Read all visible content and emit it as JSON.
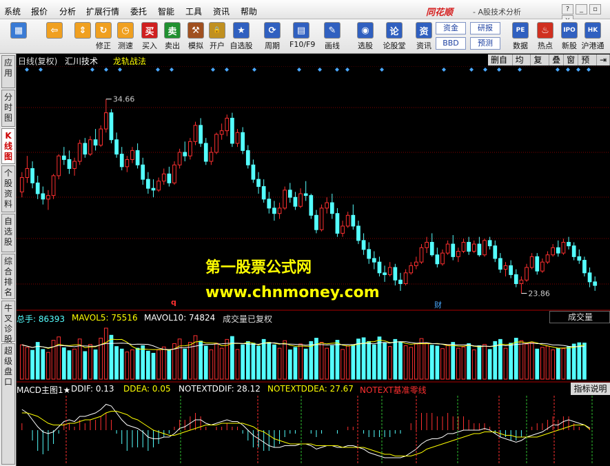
{
  "menu": [
    "系统",
    "报价",
    "分析",
    "扩展行情",
    "委托",
    "智能",
    "工具",
    "资讯",
    "帮助"
  ],
  "brand": "同花顺",
  "app_title": "- A股技术分析",
  "toolbar": [
    {
      "label": "",
      "icon": "windows-icon",
      "color": "#3a7bd5"
    },
    {
      "label": "",
      "icon": "back-arrow-icon",
      "color": "#f0a020"
    },
    {
      "label": "",
      "icon": "up-down-icon",
      "color": "#f0a020"
    },
    {
      "label": "修正",
      "icon": "refresh-icon",
      "color": "#f0a020"
    },
    {
      "label": "测速",
      "icon": "clock-icon",
      "color": "#f0a020"
    },
    {
      "label": "买入",
      "icon": "buy-icon",
      "color": "#d02020"
    },
    {
      "label": "卖出",
      "icon": "sell-icon",
      "color": "#209030"
    },
    {
      "label": "模拟",
      "icon": "hammer-icon",
      "color": "#a05020"
    },
    {
      "label": "开户",
      "icon": "lock-icon",
      "color": "#c09020"
    },
    {
      "label": "自选股",
      "icon": "star-folder-icon",
      "color": "#3060c0"
    },
    {
      "label": "周期",
      "icon": "cycle-icon",
      "color": "#3060c0"
    },
    {
      "label": "F10/F9",
      "icon": "f10-icon",
      "color": "#3060c0"
    },
    {
      "label": "画线",
      "icon": "pen-icon",
      "color": "#3060c0"
    },
    {
      "label": "选股",
      "icon": "select-stock-icon",
      "color": "#3060c0"
    },
    {
      "label": "论股堂",
      "icon": "forum-icon",
      "color": "#3060c0"
    },
    {
      "label": "资讯",
      "icon": "news-icon",
      "color": "#3060c0"
    },
    {
      "label": "数据",
      "icon": "pe-icon",
      "color": "#3060c0"
    },
    {
      "label": "热点",
      "icon": "fire-icon",
      "color": "#d03020"
    },
    {
      "label": "新股",
      "icon": "ipo-icon",
      "color": "#3060c0"
    },
    {
      "label": "沪港通",
      "icon": "sse-hk-icon",
      "color": "#3060c0"
    }
  ],
  "toolbar_small": {
    "zijin": "资金",
    "bbd": "BBD",
    "yanbao": "研报",
    "yuce": "预测"
  },
  "side_tabs": [
    "应用",
    "分时图",
    "K线图",
    "个股资料",
    "自选股",
    "综合排名",
    "牛叉诊股",
    "超级盘口"
  ],
  "info": {
    "period": "日线(复权)",
    "stock": "汇川技术",
    "strategy": "龙轨战法"
  },
  "chart_tools": [
    "删自选",
    "均线",
    "复权",
    "叠",
    "窗",
    "预测",
    "⇥"
  ],
  "price_labels": {
    "high": "34.66",
    "low": "23.86"
  },
  "markers": {
    "q": "q",
    "cai": "财"
  },
  "volume_header": {
    "total": "总手: 86393",
    "mavol5": "MAVOL5: 75516",
    "mavol10": "MAVOL10: 74824",
    "note": "成交量已复权",
    "select": "成交量"
  },
  "macd_header": {
    "name": "MACD主图1★",
    "ddif": "DDIF: 0.13",
    "ddea": "DDEA: 0.05",
    "ntddif": "NOTEXTDDIF: 28.12",
    "ntddea": "NOTEXTDDEA: 27.67",
    "baseline": "NOTEXT基准零线",
    "btn": "指标说明"
  },
  "watermark": {
    "line1": "第一股票公式网",
    "line2": "www.chnmoney.com"
  },
  "colors": {
    "up": "#ff3030",
    "down": "#54ffff",
    "ma_white": "#ffffff",
    "ma_yellow": "#ffff00",
    "grid": "#880000"
  },
  "chart_data": {
    "type": "candlestick",
    "ohlc": [
      [
        29.5,
        30.6,
        29.2,
        30.3
      ],
      [
        30.3,
        31.5,
        30.0,
        30.8
      ],
      [
        30.8,
        31.2,
        29.7,
        30.0
      ],
      [
        30.0,
        30.4,
        29.1,
        29.4
      ],
      [
        29.4,
        29.8,
        28.8,
        29.1
      ],
      [
        29.1,
        29.6,
        28.5,
        29.3
      ],
      [
        29.3,
        30.5,
        29.1,
        30.4
      ],
      [
        30.4,
        31.6,
        30.2,
        31.5
      ],
      [
        31.5,
        32.0,
        31.0,
        31.3
      ],
      [
        31.3,
        31.8,
        30.5,
        30.8
      ],
      [
        30.8,
        31.4,
        30.4,
        31.2
      ],
      [
        31.2,
        32.4,
        31.0,
        32.2
      ],
      [
        32.2,
        32.5,
        31.4,
        31.6
      ],
      [
        31.6,
        32.6,
        31.5,
        32.4
      ],
      [
        32.4,
        33.0,
        31.8,
        32.1
      ],
      [
        32.1,
        33.2,
        32.0,
        33.0
      ],
      [
        33.0,
        34.66,
        32.8,
        33.9
      ],
      [
        33.9,
        34.1,
        32.2,
        32.4
      ],
      [
        32.4,
        32.8,
        31.4,
        31.6
      ],
      [
        31.6,
        32.0,
        30.7,
        30.9
      ],
      [
        30.9,
        31.5,
        30.6,
        31.3
      ],
      [
        31.3,
        32.0,
        31.1,
        31.8
      ],
      [
        31.8,
        32.2,
        30.8,
        31.0
      ],
      [
        31.0,
        31.4,
        29.9,
        30.2
      ],
      [
        30.2,
        30.6,
        29.4,
        29.7
      ],
      [
        29.7,
        30.2,
        29.2,
        29.6
      ],
      [
        29.6,
        30.3,
        29.5,
        30.1
      ],
      [
        30.1,
        30.8,
        29.9,
        30.5
      ],
      [
        30.5,
        30.9,
        29.8,
        30.0
      ],
      [
        30.0,
        31.2,
        29.9,
        31.0
      ],
      [
        31.0,
        31.9,
        30.8,
        31.7
      ],
      [
        31.7,
        32.3,
        31.2,
        31.5
      ],
      [
        31.5,
        32.5,
        31.3,
        32.3
      ],
      [
        32.3,
        33.4,
        32.1,
        33.2
      ],
      [
        33.2,
        33.6,
        32.0,
        32.2
      ],
      [
        32.2,
        32.5,
        31.0,
        31.2
      ],
      [
        31.2,
        32.0,
        31.0,
        31.7
      ],
      [
        31.7,
        32.8,
        31.6,
        32.7
      ],
      [
        32.7,
        33.3,
        32.4,
        32.9
      ],
      [
        32.9,
        33.8,
        32.6,
        33.6
      ],
      [
        33.6,
        33.9,
        32.0,
        32.2
      ],
      [
        32.2,
        33.0,
        32.0,
        32.8
      ],
      [
        32.8,
        33.1,
        31.6,
        31.8
      ],
      [
        31.8,
        32.1,
        30.8,
        31.0
      ],
      [
        31.0,
        31.3,
        30.0,
        30.2
      ],
      [
        30.2,
        30.6,
        29.4,
        29.8
      ],
      [
        29.8,
        30.2,
        28.9,
        29.1
      ],
      [
        29.1,
        29.5,
        28.3,
        28.6
      ],
      [
        28.6,
        29.0,
        27.9,
        28.3
      ],
      [
        28.3,
        28.9,
        28.0,
        28.6
      ],
      [
        28.6,
        29.8,
        28.5,
        29.6
      ],
      [
        29.6,
        30.0,
        28.9,
        29.2
      ],
      [
        29.2,
        29.5,
        28.5,
        28.7
      ],
      [
        28.7,
        29.7,
        28.6,
        29.4
      ],
      [
        29.4,
        30.1,
        29.0,
        29.3
      ],
      [
        29.3,
        29.4,
        28.0,
        28.2
      ],
      [
        28.2,
        28.5,
        27.2,
        27.4
      ],
      [
        27.4,
        28.8,
        27.3,
        28.6
      ],
      [
        28.6,
        29.2,
        28.3,
        28.9
      ],
      [
        28.9,
        29.4,
        28.0,
        28.3
      ],
      [
        28.3,
        28.6,
        27.0,
        27.2
      ],
      [
        27.2,
        27.9,
        27.0,
        27.6
      ],
      [
        27.6,
        28.4,
        27.5,
        28.2
      ],
      [
        28.2,
        28.8,
        27.4,
        27.6
      ],
      [
        27.6,
        27.9,
        26.6,
        26.8
      ],
      [
        26.8,
        27.2,
        26.0,
        26.3
      ],
      [
        26.3,
        26.7,
        25.5,
        25.8
      ],
      [
        25.8,
        26.2,
        25.2,
        25.6
      ],
      [
        25.6,
        25.9,
        24.8,
        25.0
      ],
      [
        25.0,
        25.4,
        24.5,
        24.9
      ],
      [
        24.9,
        25.6,
        24.8,
        25.3
      ],
      [
        25.3,
        25.5,
        24.3,
        24.6
      ],
      [
        24.6,
        25.0,
        24.0,
        24.4
      ],
      [
        24.4,
        25.2,
        24.3,
        25.0
      ],
      [
        25.0,
        25.6,
        24.9,
        25.4
      ],
      [
        25.4,
        25.9,
        25.2,
        25.6
      ],
      [
        25.6,
        26.6,
        25.5,
        26.4
      ],
      [
        26.4,
        27.0,
        26.1,
        26.7
      ],
      [
        26.7,
        27.2,
        25.9,
        26.0
      ],
      [
        26.0,
        26.4,
        25.3,
        25.5
      ],
      [
        25.5,
        26.3,
        25.4,
        26.1
      ],
      [
        26.1,
        26.8,
        26.0,
        26.6
      ],
      [
        26.6,
        27.1,
        25.7,
        25.9
      ],
      [
        25.9,
        26.4,
        25.6,
        26.2
      ],
      [
        26.2,
        26.9,
        26.1,
        26.7
      ],
      [
        26.7,
        27.0,
        26.0,
        26.2
      ],
      [
        26.2,
        26.8,
        26.1,
        26.6
      ],
      [
        26.6,
        27.0,
        25.9,
        26.0
      ],
      [
        26.0,
        26.9,
        25.9,
        26.8
      ],
      [
        26.8,
        27.0,
        26.3,
        26.5
      ],
      [
        26.5,
        26.8,
        25.6,
        25.8
      ],
      [
        25.8,
        26.1,
        25.0,
        25.2
      ],
      [
        25.2,
        25.6,
        24.8,
        25.4
      ],
      [
        25.4,
        25.7,
        24.7,
        24.9
      ],
      [
        24.9,
        25.2,
        24.2,
        24.4
      ],
      [
        24.4,
        24.8,
        23.86,
        24.6
      ],
      [
        24.6,
        25.5,
        24.5,
        25.3
      ],
      [
        25.3,
        26.1,
        25.2,
        25.9
      ],
      [
        25.9,
        26.1,
        24.9,
        25.1
      ],
      [
        25.1,
        25.8,
        25.0,
        25.6
      ],
      [
        25.6,
        26.2,
        25.5,
        26.0
      ],
      [
        26.0,
        26.6,
        25.9,
        26.4
      ],
      [
        26.4,
        26.8,
        25.9,
        26.1
      ],
      [
        26.1,
        26.9,
        26.0,
        26.7
      ],
      [
        26.7,
        27.0,
        26.3,
        26.5
      ],
      [
        26.5,
        26.7,
        25.7,
        25.9
      ],
      [
        25.9,
        26.3,
        25.5,
        25.7
      ],
      [
        25.7,
        25.9,
        24.8,
        25.0
      ],
      [
        25.0,
        25.3,
        24.2,
        24.5
      ],
      [
        24.5,
        24.8,
        24.0,
        24.3
      ]
    ],
    "volume": [
      82000,
      76000,
      69000,
      88000,
      71000,
      64000,
      93000,
      101000,
      75000,
      68000,
      72000,
      96000,
      66000,
      83000,
      70000,
      98000,
      122000,
      105000,
      78000,
      72000,
      65000,
      70000,
      74000,
      80000,
      67000,
      62000,
      70000,
      77000,
      69000,
      85000,
      96000,
      72000,
      88000,
      104000,
      91000,
      79000,
      70000,
      86000,
      74000,
      95000,
      102000,
      71000,
      82000,
      90000,
      86000,
      79000,
      95000,
      88000,
      82000,
      74000,
      92000,
      70000,
      76000,
      84000,
      72000,
      90000,
      98000,
      88000,
      74000,
      80000,
      93000,
      71000,
      79000,
      81000,
      96000,
      99000,
      90000,
      82000,
      101000,
      86000,
      78000,
      95000,
      88000,
      80000,
      76000,
      84000,
      97000,
      86000,
      81000,
      79000,
      73000,
      82000,
      88000,
      74000,
      77000,
      85000,
      70000,
      80000,
      83000,
      71000,
      90000,
      95000,
      74000,
      86000,
      98000,
      92000,
      84000,
      87000,
      72000,
      76000,
      79000,
      70000,
      74000,
      73000,
      78000,
      84000,
      87000,
      86393
    ],
    "macd_ddif": [
      1.2,
      1.0,
      0.6,
      0.2,
      -0.1,
      -0.2,
      -0.1,
      0.2,
      0.5,
      0.6,
      0.5,
      0.8,
      0.8,
      0.9,
      1.0,
      1.2,
      1.5,
      1.4,
      1.0,
      0.6,
      0.3,
      0.2,
      0.1,
      -0.1,
      -0.4,
      -0.5,
      -0.5,
      -0.4,
      -0.4,
      -0.2,
      0.1,
      0.2,
      0.4,
      0.6,
      0.6,
      0.4,
      0.3,
      0.4,
      0.5,
      0.6,
      0.5,
      0.5,
      0.3,
      0.0,
      -0.3,
      -0.5,
      -0.7,
      -0.9,
      -1.0,
      -1.0,
      -0.9,
      -0.9,
      -0.9,
      -0.8,
      -0.8,
      -0.9,
      -1.1,
      -1.0,
      -0.9,
      -0.9,
      -1.0,
      -1.0,
      -0.9,
      -0.9,
      -1.0,
      -1.1,
      -1.3,
      -1.4,
      -1.5,
      -1.6,
      -1.6,
      -1.6,
      -1.6,
      -1.5,
      -1.3,
      -1.1,
      -0.8,
      -0.6,
      -0.5,
      -0.5,
      -0.4,
      -0.2,
      -0.2,
      -0.1,
      0.0,
      0.0,
      0.0,
      0.0,
      0.1,
      0.0,
      -0.2,
      -0.4,
      -0.5,
      -0.6,
      -0.7,
      -0.6,
      -0.4,
      -0.3,
      -0.2,
      -0.1,
      0.1,
      0.3,
      0.3,
      0.5,
      0.6,
      0.5,
      0.4,
      0.3,
      0.13
    ],
    "macd_ddea": [
      1.0,
      1.0,
      0.9,
      0.8,
      0.6,
      0.4,
      0.3,
      0.3,
      0.3,
      0.4,
      0.4,
      0.5,
      0.6,
      0.6,
      0.7,
      0.8,
      1.0,
      1.1,
      1.1,
      1.0,
      0.9,
      0.7,
      0.6,
      0.4,
      0.2,
      0.0,
      -0.1,
      -0.2,
      -0.3,
      -0.3,
      -0.2,
      -0.1,
      0.0,
      0.1,
      0.2,
      0.3,
      0.3,
      0.3,
      0.4,
      0.4,
      0.4,
      0.4,
      0.4,
      0.3,
      0.2,
      0.0,
      -0.1,
      -0.3,
      -0.5,
      -0.6,
      -0.7,
      -0.8,
      -0.8,
      -0.8,
      -0.8,
      -0.8,
      -0.9,
      -0.9,
      -0.9,
      -0.9,
      -0.9,
      -1.0,
      -1.0,
      -1.0,
      -1.0,
      -1.0,
      -1.1,
      -1.2,
      -1.3,
      -1.4,
      -1.4,
      -1.5,
      -1.5,
      -1.5,
      -1.5,
      -1.4,
      -1.3,
      -1.1,
      -1.0,
      -0.9,
      -0.8,
      -0.7,
      -0.6,
      -0.5,
      -0.4,
      -0.3,
      -0.2,
      -0.2,
      -0.1,
      -0.1,
      -0.1,
      -0.2,
      -0.3,
      -0.3,
      -0.4,
      -0.4,
      -0.4,
      -0.4,
      -0.4,
      -0.3,
      -0.2,
      -0.1,
      0.0,
      0.1,
      0.2,
      0.3,
      0.3,
      0.3,
      0.05
    ],
    "ylim": [
      23.0,
      35.8
    ]
  }
}
